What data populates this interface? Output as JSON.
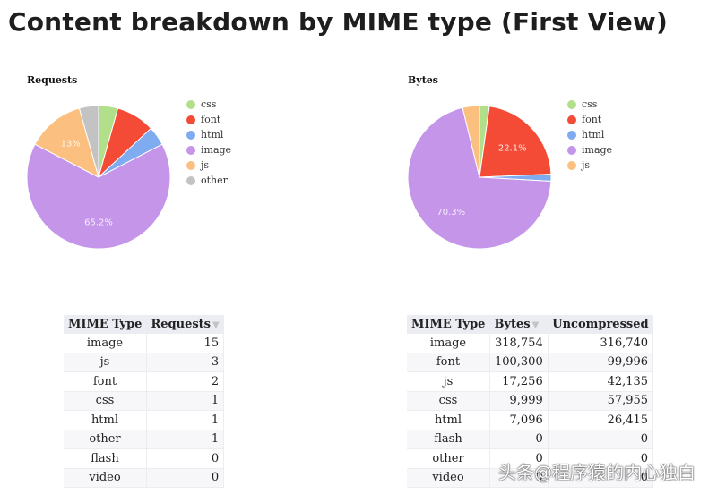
{
  "page": {
    "title": "Content breakdown by MIME type (First View)"
  },
  "chart_data": [
    {
      "type": "pie",
      "title": "Requests",
      "categories": [
        "css",
        "font",
        "html",
        "image",
        "js",
        "other"
      ],
      "values": [
        1,
        2,
        1,
        15,
        3,
        1
      ],
      "colors": [
        "#b2df8a",
        "#f44b36",
        "#7fabf0",
        "#c495e9",
        "#fbbf7f",
        "#c3c3c3"
      ],
      "slice_labels": [
        {
          "category": "image",
          "text": "65.2%"
        },
        {
          "category": "js",
          "text": "13%"
        }
      ],
      "legend": [
        "css",
        "font",
        "html",
        "image",
        "js",
        "other"
      ],
      "legend_position": "right"
    },
    {
      "type": "pie",
      "title": "Bytes",
      "categories": [
        "css",
        "font",
        "html",
        "image",
        "js"
      ],
      "values": [
        9999,
        100300,
        7096,
        318754,
        17256
      ],
      "colors": [
        "#b2df8a",
        "#f44b36",
        "#7fabf0",
        "#c495e9",
        "#fbbf7f"
      ],
      "slice_labels": [
        {
          "category": "font",
          "text": "22.1%"
        },
        {
          "category": "image",
          "text": "70.3%"
        }
      ],
      "legend": [
        "css",
        "font",
        "html",
        "image",
        "js"
      ],
      "legend_position": "right"
    },
    {
      "type": "table",
      "columns": [
        "MIME Type",
        "Requests"
      ],
      "sorted_column": "Requests",
      "rows": [
        [
          "image",
          "15"
        ],
        [
          "js",
          "3"
        ],
        [
          "font",
          "2"
        ],
        [
          "css",
          "1"
        ],
        [
          "html",
          "1"
        ],
        [
          "other",
          "1"
        ],
        [
          "flash",
          "0"
        ],
        [
          "video",
          "0"
        ]
      ]
    },
    {
      "type": "table",
      "columns": [
        "MIME Type",
        "Bytes",
        "Uncompressed"
      ],
      "sorted_column": "Bytes",
      "rows": [
        [
          "image",
          "318,754",
          "316,740"
        ],
        [
          "font",
          "100,300",
          "99,996"
        ],
        [
          "js",
          "17,256",
          "42,135"
        ],
        [
          "css",
          "9,999",
          "57,955"
        ],
        [
          "html",
          "7,096",
          "26,415"
        ],
        [
          "flash",
          "0",
          "0"
        ],
        [
          "other",
          "0",
          "0"
        ],
        [
          "video",
          "0",
          "0"
        ]
      ]
    }
  ],
  "icons": {
    "sort": "sort-desc-triangle"
  },
  "watermark": "头条@程序猿的内心独白"
}
